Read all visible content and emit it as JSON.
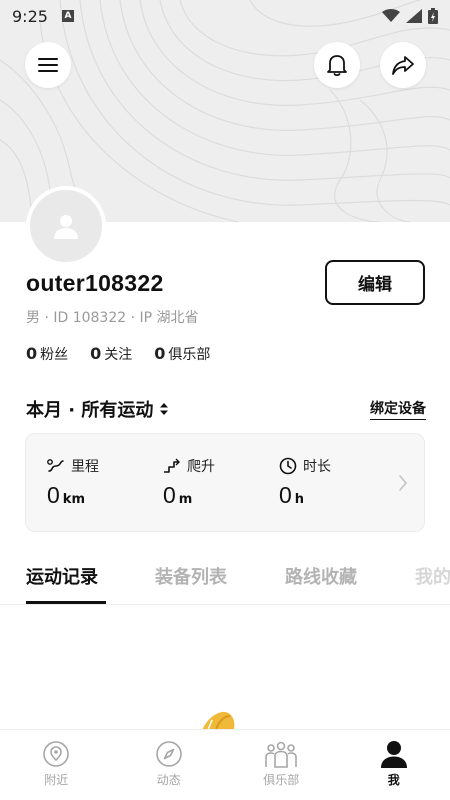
{
  "status_bar": {
    "time": "9:25",
    "indicator": "A"
  },
  "profile": {
    "username": "outer108322",
    "subinfo": "男 · ID 108322 · IP 湖北省",
    "edit_label": "编辑"
  },
  "counts": [
    {
      "value": "0",
      "label": "粉丝"
    },
    {
      "value": "0",
      "label": "关注"
    },
    {
      "value": "0",
      "label": "俱乐部"
    }
  ],
  "filter": {
    "title": "本月 · 所有运动",
    "bind_device": "绑定设备"
  },
  "stats": [
    {
      "icon": "distance-icon",
      "label": "里程",
      "value": "0",
      "unit": "km"
    },
    {
      "icon": "climb-icon",
      "label": "爬升",
      "value": "0",
      "unit": "m"
    },
    {
      "icon": "clock-icon",
      "label": "时长",
      "value": "0",
      "unit": "h"
    }
  ],
  "tabs": [
    {
      "label": "运动记录",
      "active": true
    },
    {
      "label": "装备列表",
      "active": false
    },
    {
      "label": "路线收藏",
      "active": false
    },
    {
      "label": "我的",
      "active": false
    }
  ],
  "bottom_nav": [
    {
      "label": "附近",
      "icon": "location-pin-icon",
      "active": false
    },
    {
      "label": "动态",
      "icon": "compass-icon",
      "active": false
    },
    {
      "label": "俱乐部",
      "icon": "group-icon",
      "active": false
    },
    {
      "label": "我",
      "icon": "person-icon",
      "active": true
    }
  ],
  "colors": {
    "accent": "#111111",
    "muted": "#a6a6a6",
    "hero_bg": "#eeeeee",
    "card_bg": "#f7f7f7"
  }
}
